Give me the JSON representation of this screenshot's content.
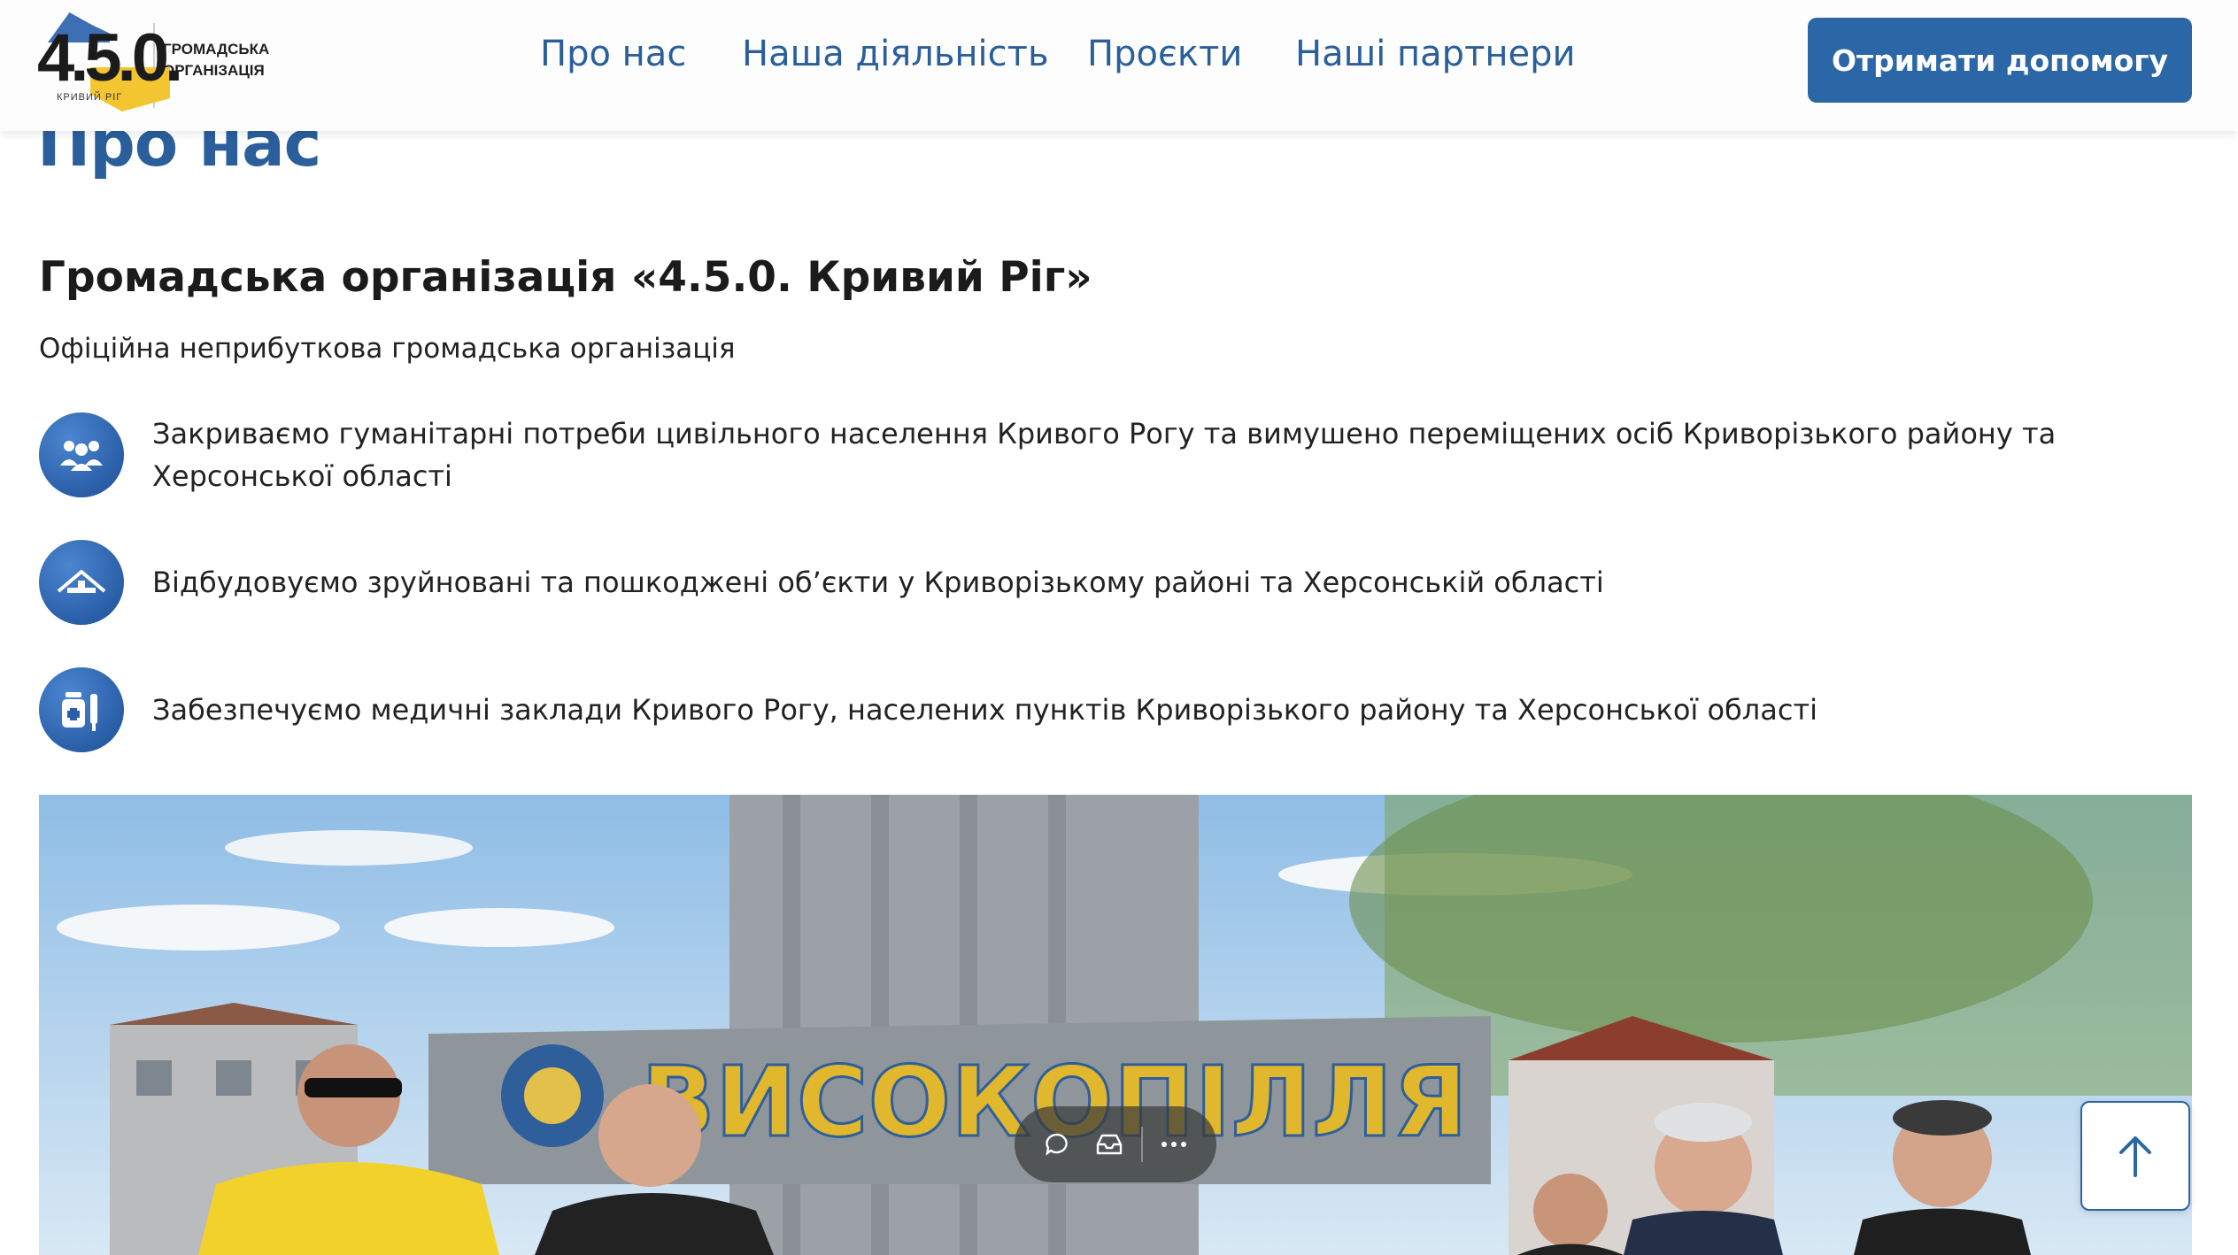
{
  "logo": {
    "number": "4.5.0.",
    "city": "КРИВИЙ РІГ",
    "text_line1": "ГРОМАДСЬКА",
    "text_line2": "ОРГАНІЗАЦІЯ"
  },
  "nav": {
    "items": [
      {
        "label": "Про нас"
      },
      {
        "label": "Наша діяльність"
      },
      {
        "label": "Проєкти"
      },
      {
        "label": "Наші партнери"
      }
    ]
  },
  "cta": {
    "label": "Отримати допомогу"
  },
  "page": {
    "title": "Про нас",
    "org_heading": "Громадська організація «4.5.0. Кривий Ріг»",
    "org_subtitle": "Офіційна неприбуткова громадська організація"
  },
  "features": [
    {
      "icon": "people-group-icon",
      "text": "Закриваємо гуманітарні потреби цивільного населення Кривого Рогу та вимушено переміщених осіб Криворізького району та Херсонської області"
    },
    {
      "icon": "rebuild-house-icon",
      "text": "Відбудовуємо зруйновані та пошкоджені об’єкти у Криворізькому районі та Херсонській області"
    },
    {
      "icon": "medicine-icon",
      "text": "Забезпечуємо медичні заклади Кривого Рогу, населених пунктів Криворізького району та Херсонської області"
    }
  ],
  "photo": {
    "sign_text": "ВИСОКОПІЛЛЯ"
  },
  "colors": {
    "brand_blue": "#2a5f9c",
    "button_blue": "#2b66a6",
    "flag_yellow": "#f2c531"
  }
}
